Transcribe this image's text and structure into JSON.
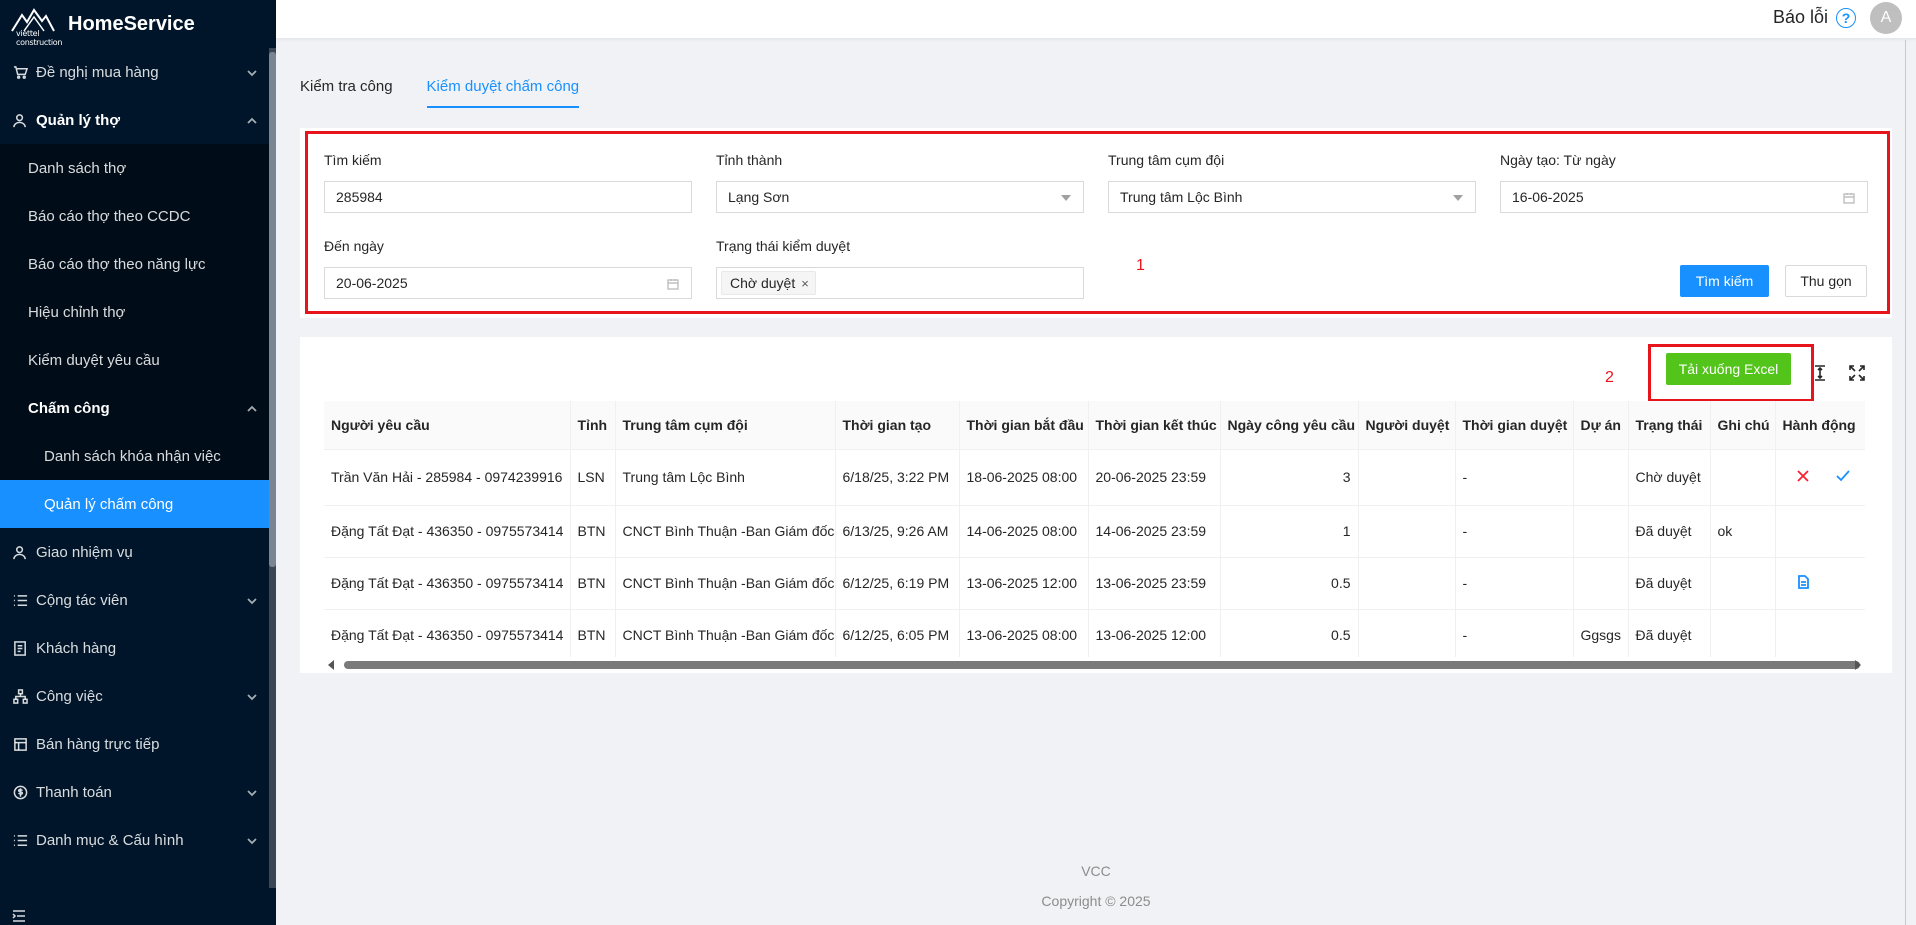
{
  "app": {
    "brand_small": "viettel construction",
    "title": "HomeService"
  },
  "header": {
    "report_label": "Báo lỗi",
    "help_glyph": "?",
    "avatar_letter": "A"
  },
  "sidebar": {
    "items": [
      {
        "label": "Đề nghị mua hàng",
        "icon": "cart-icon"
      },
      {
        "label": "Quản lý thợ",
        "icon": "worker-icon"
      },
      {
        "label": "Danh sách thợ"
      },
      {
        "label": "Báo cáo thợ theo CCDC"
      },
      {
        "label": "Báo cáo thợ theo năng lực"
      },
      {
        "label": "Hiệu chỉnh thợ"
      },
      {
        "label": "Kiểm duyệt yêu cầu"
      },
      {
        "label": "Chấm công"
      },
      {
        "label": "Danh sách khóa nhận việc"
      },
      {
        "label": "Quản lý chấm công"
      },
      {
        "label": "Giao nhiệm vụ",
        "icon": "user-icon"
      },
      {
        "label": "Cộng tác viên",
        "icon": "list-icon"
      },
      {
        "label": "Khách hàng",
        "icon": "customer-icon"
      },
      {
        "label": "Công việc",
        "icon": "tree-icon"
      },
      {
        "label": "Bán hàng trực tiếp",
        "icon": "shop-icon"
      },
      {
        "label": "Thanh toán",
        "icon": "dollar-icon"
      },
      {
        "label": "Danh mục & Cấu hình",
        "icon": "list-icon"
      }
    ]
  },
  "tabs": [
    {
      "label": "Kiểm tra công",
      "active": false
    },
    {
      "label": "Kiểm duyệt chấm công",
      "active": true
    }
  ],
  "search": {
    "keyword_label": "Tìm kiếm",
    "keyword_value": "285984",
    "province_label": "Tỉnh thành",
    "province_value": "Lạng Sơn",
    "center_label": "Trung tâm cụm đội",
    "center_value": "Trung tâm Lộc Bình",
    "from_label": "Ngày tạo: Từ ngày",
    "from_value": "16-06-2025",
    "to_label": "Đến ngày",
    "to_value": "20-06-2025",
    "status_label": "Trạng thái kiểm duyệt",
    "status_tag": "Chờ duyệt",
    "search_button": "Tìm kiếm",
    "collapse_button": "Thu gọn",
    "marker": "1"
  },
  "toolbar": {
    "excel_button": "Tải xuống Excel",
    "marker": "2"
  },
  "table": {
    "columns": [
      "Người yêu cầu",
      "Tỉnh",
      "Trung tâm cụm đội",
      "Thời gian tạo",
      "Thời gian bắt đầu",
      "Thời gian kết thúc",
      "Ngày công yêu cầu",
      "Người duyệt",
      "Thời gian duyệt",
      "Dự án",
      "Trạng thái",
      "Ghi chú",
      "Hành động"
    ],
    "rows": [
      {
        "requester": "Trần Văn Hải - 285984 - 0974239916",
        "province": "LSN",
        "center": "Trung tâm Lộc Bình",
        "created": "6/18/25, 3:22 PM",
        "start": "18-06-2025 08:00",
        "end": "20-06-2025 23:59",
        "days": "3",
        "approver": "",
        "approved_at": "-",
        "project": "",
        "status": "Chờ duyệt",
        "note": ""
      },
      {
        "requester": "Đặng Tất Đạt - 436350 - 0975573414",
        "province": "BTN",
        "center": "CNCT Bình Thuận -Ban Giám đốc",
        "created": "6/13/25, 9:26 AM",
        "start": "14-06-2025 08:00",
        "end": "14-06-2025 23:59",
        "days": "1",
        "approver": "",
        "approved_at": "-",
        "project": "",
        "status": "Đã duyệt",
        "note": "ok"
      },
      {
        "requester": "Đặng Tất Đạt - 436350 - 0975573414",
        "province": "BTN",
        "center": "CNCT Bình Thuận -Ban Giám đốc",
        "created": "6/12/25, 6:19 PM",
        "start": "13-06-2025 12:00",
        "end": "13-06-2025 23:59",
        "days": "0.5",
        "approver": "",
        "approved_at": "-",
        "project": "",
        "status": "Đã duyệt",
        "note": ""
      },
      {
        "requester": "Đặng Tất Đạt - 436350 - 0975573414",
        "province": "BTN",
        "center": "CNCT Bình Thuận -Ban Giám đốc",
        "created": "6/12/25, 6:05 PM",
        "start": "13-06-2025 08:00",
        "end": "13-06-2025 12:00",
        "days": "0.5",
        "approver": "",
        "approved_at": "-",
        "project": "Ggsgs",
        "status": "Đã duyệt",
        "note": ""
      }
    ]
  },
  "footer": {
    "company": "VCC",
    "copyright": "Copyright © 2025"
  },
  "colors": {
    "sidebar_bg": "#001529",
    "submenu_bg": "#000c17",
    "primary": "#1890ff",
    "success": "#52c41a",
    "highlight_red": "#e8141c",
    "reject_red": "#f5222d"
  }
}
